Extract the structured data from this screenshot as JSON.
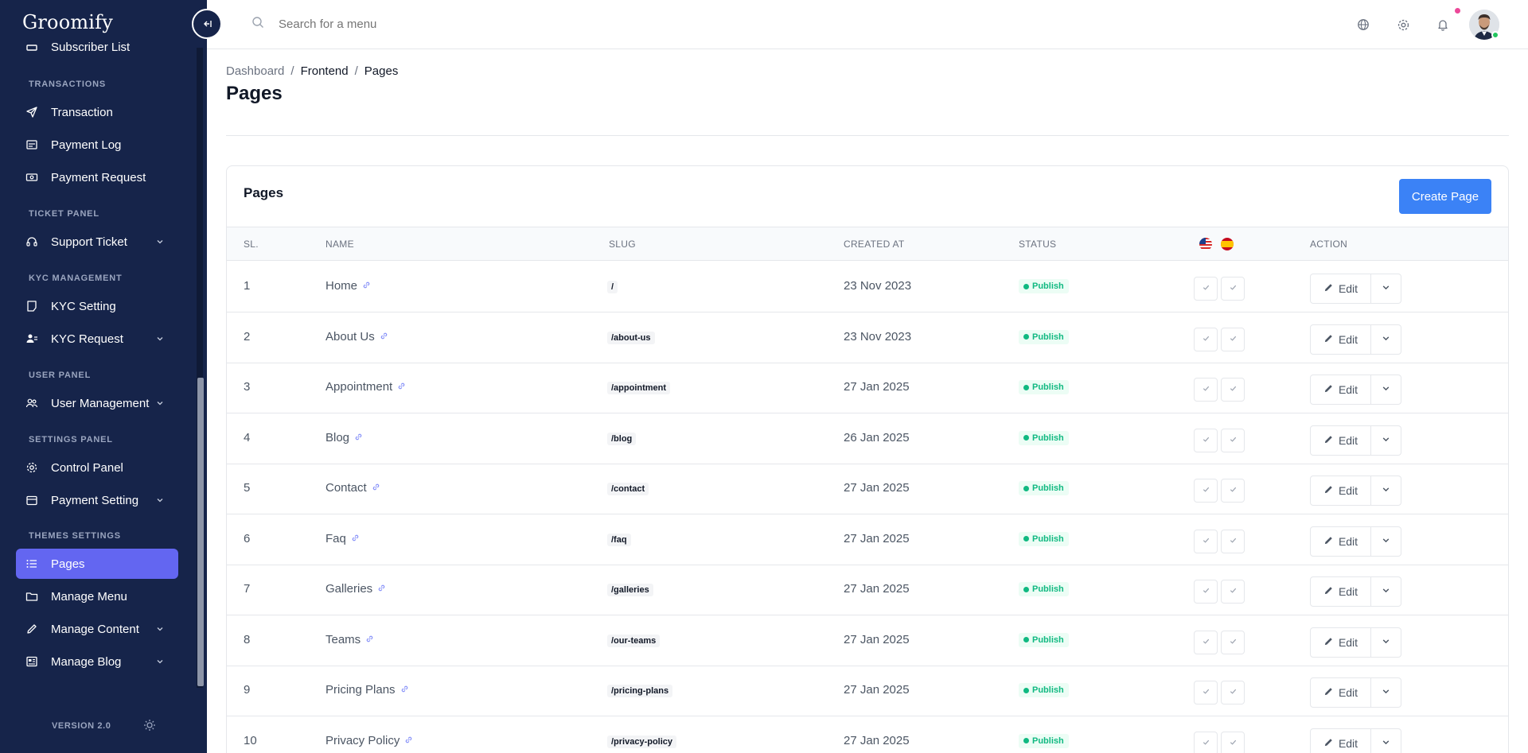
{
  "app": {
    "logo": "Groomify"
  },
  "sidebar": {
    "partial_item": "Subscriber List",
    "sections": [
      {
        "title": "TRANSACTIONS",
        "items": [
          {
            "label": "Transaction",
            "icon": "send-icon"
          },
          {
            "label": "Payment Log",
            "icon": "receipt-icon"
          },
          {
            "label": "Payment Request",
            "icon": "money-icon"
          }
        ]
      },
      {
        "title": "TICKET PANEL",
        "items": [
          {
            "label": "Support Ticket",
            "icon": "headset-icon",
            "has_submenu": true
          }
        ]
      },
      {
        "title": "KYC MANAGEMENT",
        "items": [
          {
            "label": "KYC Setting",
            "icon": "note-icon"
          },
          {
            "label": "KYC Request",
            "icon": "users-icon",
            "has_submenu": true
          }
        ]
      },
      {
        "title": "USER PANEL",
        "items": [
          {
            "label": "User Management",
            "icon": "user-group-icon",
            "has_submenu": true
          }
        ]
      },
      {
        "title": "SETTINGS PANEL",
        "items": [
          {
            "label": "Control Panel",
            "icon": "gear-icon"
          },
          {
            "label": "Payment Setting",
            "icon": "wallet-icon",
            "has_submenu": true
          }
        ]
      },
      {
        "title": "THEMES SETTINGS",
        "items": [
          {
            "label": "Pages",
            "icon": "list-icon",
            "active": true
          },
          {
            "label": "Manage Menu",
            "icon": "folder-icon"
          },
          {
            "label": "Manage Content",
            "icon": "pencil-icon",
            "has_submenu": true
          },
          {
            "label": "Manage Blog",
            "icon": "newspaper-icon",
            "has_submenu": true
          }
        ]
      }
    ],
    "version": "VERSION 2.0"
  },
  "topbar": {
    "search_placeholder": "Search for a menu"
  },
  "breadcrumb": {
    "items": [
      "Dashboard",
      "Frontend",
      "Pages"
    ],
    "separator": "/"
  },
  "page_title": "Pages",
  "card": {
    "title": "Pages",
    "create_button": "Create Page",
    "columns": {
      "sl": "SL.",
      "name": "NAME",
      "slug": "SLUG",
      "created_at": "CREATED AT",
      "status": "STATUS",
      "action": "ACTION"
    },
    "languages": [
      "en-flag-icon",
      "es-flag-icon"
    ],
    "edit_label": "Edit",
    "rows": [
      {
        "sl": "1",
        "name": "Home",
        "slug": "/",
        "created_at": "23 Nov 2023",
        "status": "Publish"
      },
      {
        "sl": "2",
        "name": "About Us",
        "slug": "/about-us",
        "created_at": "23 Nov 2023",
        "status": "Publish"
      },
      {
        "sl": "3",
        "name": "Appointment",
        "slug": "/appointment",
        "created_at": "27 Jan 2025",
        "status": "Publish"
      },
      {
        "sl": "4",
        "name": "Blog",
        "slug": "/blog",
        "created_at": "26 Jan 2025",
        "status": "Publish"
      },
      {
        "sl": "5",
        "name": "Contact",
        "slug": "/contact",
        "created_at": "27 Jan 2025",
        "status": "Publish"
      },
      {
        "sl": "6",
        "name": "Faq",
        "slug": "/faq",
        "created_at": "27 Jan 2025",
        "status": "Publish"
      },
      {
        "sl": "7",
        "name": "Galleries",
        "slug": "/galleries",
        "created_at": "27 Jan 2025",
        "status": "Publish"
      },
      {
        "sl": "8",
        "name": "Teams",
        "slug": "/our-teams",
        "created_at": "27 Jan 2025",
        "status": "Publish"
      },
      {
        "sl": "9",
        "name": "Pricing Plans",
        "slug": "/pricing-plans",
        "created_at": "27 Jan 2025",
        "status": "Publish"
      },
      {
        "sl": "10",
        "name": "Privacy Policy",
        "slug": "/privacy-policy",
        "created_at": "27 Jan 2025",
        "status": "Publish"
      }
    ]
  },
  "colors": {
    "sidebar_bg": "#16244a",
    "active_item": "#6366f1",
    "primary_button": "#3b82f6",
    "publish_green": "#10b981"
  }
}
